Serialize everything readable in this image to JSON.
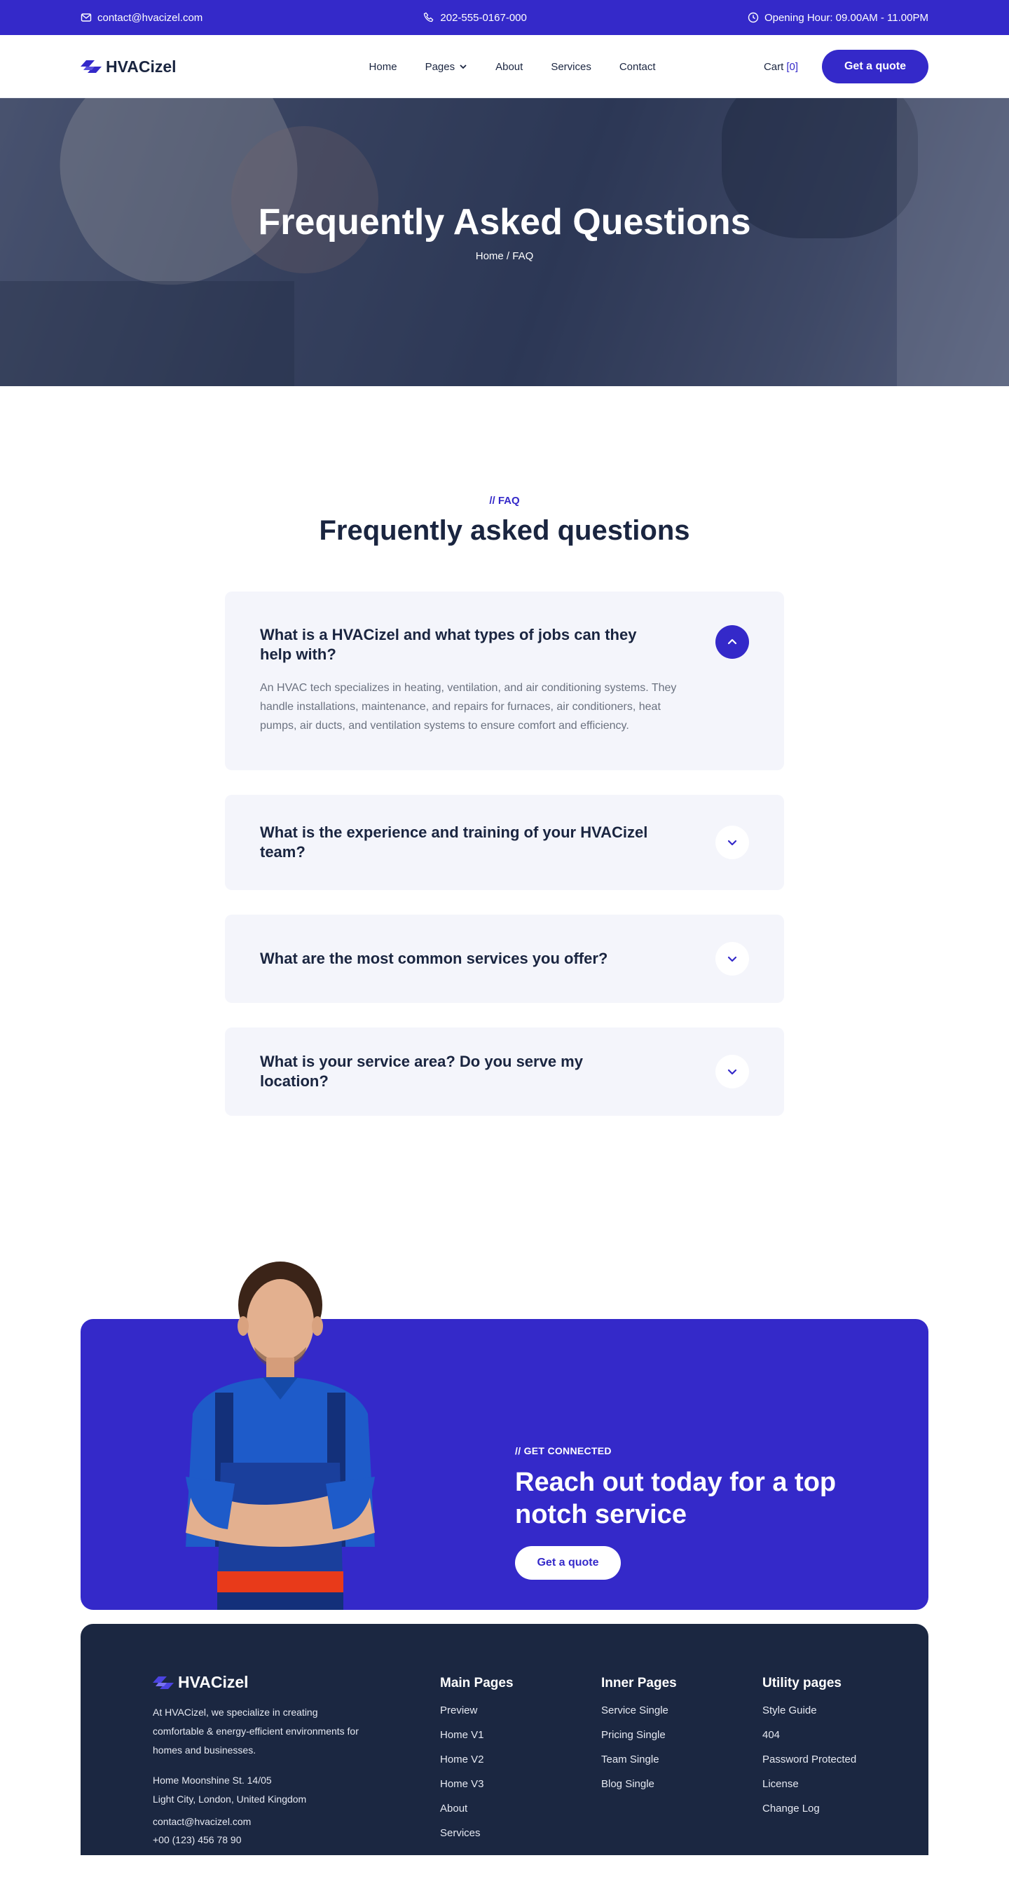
{
  "topbar": {
    "email": "contact@hvacizel.com",
    "phone": "202-555-0167-000",
    "hours": "Opening Hour: 09.00AM - 11.00PM"
  },
  "brand": {
    "name": "HVACizel",
    "color": "#3429c9"
  },
  "nav": {
    "items": [
      "Home",
      "Pages",
      "About",
      "Services",
      "Contact"
    ],
    "cart_label": "Cart",
    "cart_count": "[0]",
    "cta": "Get a quote"
  },
  "hero": {
    "title": "Frequently Asked Questions",
    "breadcrumb": "Home / FAQ"
  },
  "faq": {
    "eyebrow": "// FAQ",
    "title": "Frequently asked questions",
    "items": [
      {
        "question": "What is a HVACizel and what types of jobs can they help with?",
        "answer": "An HVAC tech specializes in heating, ventilation, and air conditioning systems. They handle installations, maintenance, and repairs for furnaces, air conditioners, heat pumps, air ducts, and ventilation systems to ensure comfort and efficiency."
      },
      {
        "question": "What is the experience and training of your HVACizel team?"
      },
      {
        "question": "What are the most common services you offer?"
      },
      {
        "question": "What is your service area? Do you serve my location?"
      }
    ]
  },
  "cta": {
    "eyebrow": "// GET CONNECTED",
    "title": "Reach out today for a top notch service",
    "button": "Get a quote"
  },
  "footer": {
    "brand": "HVACizel",
    "description": "At HVACizel, we specialize in creating comfortable & energy-efficient environments for homes and businesses.",
    "address_line1": "Home Moonshine St. 14/05",
    "address_line2": "Light City, London, United Kingdom",
    "email": "contact@hvacizel.com",
    "phone": "+00 (123) 456 78 90",
    "columns": [
      {
        "title": "Main Pages",
        "links": [
          "Preview",
          "Home V1",
          "Home V2",
          "Home V3",
          "About",
          "Services"
        ]
      },
      {
        "title": "Inner Pages",
        "links": [
          "Service Single",
          "Pricing Single",
          "Team Single",
          "Blog Single"
        ]
      },
      {
        "title": "Utility pages",
        "links": [
          "Style Guide",
          "404",
          "Password Protected",
          "License",
          "Change Log"
        ]
      }
    ]
  }
}
